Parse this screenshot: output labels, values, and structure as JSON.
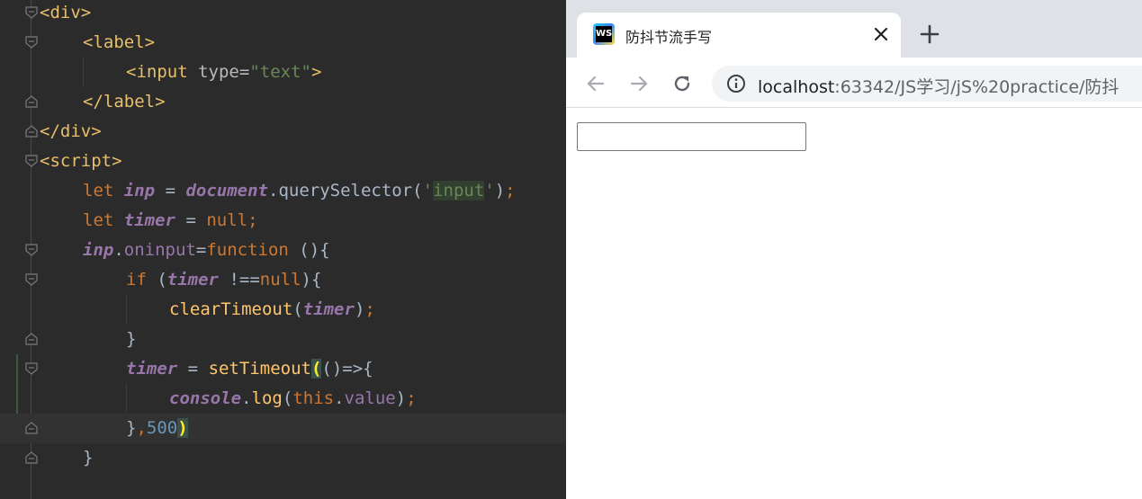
{
  "editor": {
    "lines": [
      {
        "open": "<",
        "tag": "div",
        "close": ">"
      },
      {
        "open": "<",
        "tag": "label",
        "close": ">"
      },
      {
        "open": "<",
        "tag": "input",
        "attr": "type",
        "eq": "=",
        "val": "\"text\"",
        "close": ">"
      },
      {
        "open": "</",
        "tag": "label",
        "close": ">"
      },
      {
        "open": "</",
        "tag": "div",
        "close": ">"
      },
      {
        "open": "<",
        "tag": "script",
        "close": ">"
      },
      {
        "kw": "let",
        "var": "inp",
        "eq": "=",
        "obj": "document",
        "dot": ".",
        "fn": "querySelector",
        "p1": "(",
        "q1": "'",
        "str": "input",
        "q2": "'",
        "p2": ")",
        "semi": ";"
      },
      {
        "kw": "let",
        "var": "timer",
        "eq": "=",
        "val": "null",
        "semi": ";"
      },
      {
        "var": "inp",
        "dot": ".",
        "prop": "oninput",
        "eq": "=",
        "kw": "function",
        "rest": "(){"
      },
      {
        "kw": "if",
        "p1": "(",
        "var": "timer",
        "op": "!==",
        "val": "null",
        "p2": "){"
      },
      {
        "fn": "clearTimeout",
        "p1": "(",
        "var": "timer",
        "p2": ")",
        "semi": ";"
      },
      {
        "text": "}"
      },
      {
        "var": "timer",
        "eq": "=",
        "fn": "setTimeout",
        "p1": "(",
        "rest": "()=>{"
      },
      {
        "obj": "console",
        "dot": ".",
        "fn": "log",
        "p1": "(",
        "kw": "this",
        "dot2": ".",
        "prop": "value",
        "p2": ")",
        "semi": ";"
      },
      {
        "text": "}",
        "comma": ",",
        "num": "500",
        "p2": ")"
      },
      {
        "text": "}"
      }
    ]
  },
  "browser": {
    "tab": {
      "favicon_text": "WS",
      "title": "防抖节流手写",
      "close_icon": "close-icon"
    },
    "new_tab_icon": "plus-icon",
    "nav": {
      "back_icon": "arrow-left-icon",
      "forward_icon": "arrow-right-icon",
      "reload_icon": "reload-icon"
    },
    "address": {
      "host": "localhost",
      "path": ":63342/JS学习/jS%20practice/防抖"
    },
    "page": {
      "input_value": ""
    }
  }
}
